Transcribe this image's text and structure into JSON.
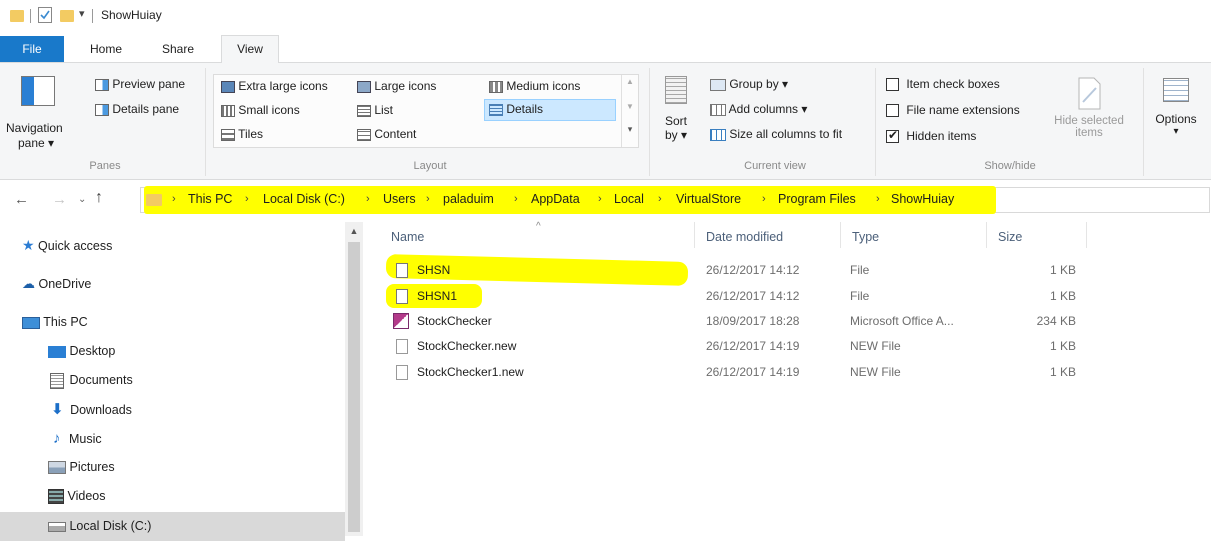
{
  "window": {
    "title": "ShowHuiay"
  },
  "tabs": [
    {
      "label": "File"
    },
    {
      "label": "Home"
    },
    {
      "label": "Share"
    },
    {
      "label": "View"
    }
  ],
  "ribbon": {
    "panes": {
      "navigation_pane_line1": "Navigation",
      "navigation_pane_line2": "pane ▾",
      "preview_pane": "Preview pane",
      "details_pane": "Details pane",
      "group_label": "Panes"
    },
    "layout": {
      "extra_large_icons": "Extra large icons",
      "large_icons": "Large icons",
      "medium_icons": "Medium icons",
      "small_icons": "Small icons",
      "list": "List",
      "details": "Details",
      "tiles": "Tiles",
      "content": "Content",
      "group_label": "Layout",
      "selected": "Details"
    },
    "current_view": {
      "sort_line1": "Sort",
      "sort_line2": "by ▾",
      "group_by": "Group by ▾",
      "add_columns": "Add columns ▾",
      "size_all_columns": "Size all columns to fit",
      "group_label": "Current view"
    },
    "show_hide": {
      "item_check_boxes": {
        "label": "Item check boxes",
        "checked": false
      },
      "file_name_extensions": {
        "label": "File name extensions",
        "checked": false
      },
      "hidden_items": {
        "label": "Hidden items",
        "checked": true
      },
      "hide_selected_line1": "Hide selected",
      "hide_selected_line2": "items",
      "group_label": "Show/hide"
    },
    "options": {
      "label": "Options",
      "arrow": "▾"
    }
  },
  "address_bar": {
    "crumbs": [
      "This PC",
      "Local Disk (C:)",
      "Users",
      "paladuim",
      "AppData",
      "Local",
      "VirtualStore",
      "Program Files",
      "ShowHuiay"
    ],
    "highlight_color": "#ffff00"
  },
  "nav_pane": {
    "items": [
      {
        "label": "Quick access",
        "icon": "star-icon"
      },
      {
        "label": "OneDrive",
        "icon": "cloud-icon"
      },
      {
        "label": "This PC",
        "icon": "computer-icon"
      },
      {
        "label": "Desktop",
        "icon": "desktop-icon"
      },
      {
        "label": "Documents",
        "icon": "documents-icon"
      },
      {
        "label": "Downloads",
        "icon": "downloads-icon"
      },
      {
        "label": "Music",
        "icon": "music-icon"
      },
      {
        "label": "Pictures",
        "icon": "pictures-icon"
      },
      {
        "label": "Videos",
        "icon": "videos-icon"
      },
      {
        "label": "Local Disk (C:)",
        "icon": "drive-icon",
        "selected": true
      }
    ]
  },
  "file_list": {
    "columns": {
      "name": "Name",
      "date_modified": "Date modified",
      "type": "Type",
      "size": "Size"
    },
    "rows": [
      {
        "name": "SHSN",
        "date": "26/12/2017 14:12",
        "type": "File",
        "size": "1 KB",
        "icon": "file-icon",
        "highlighted": true
      },
      {
        "name": "SHSN1",
        "date": "26/12/2017 14:12",
        "type": "File",
        "size": "1 KB",
        "icon": "file-icon",
        "highlighted": true
      },
      {
        "name": "StockChecker",
        "date": "18/09/2017 18:28",
        "type": "Microsoft Office A...",
        "size": "234 KB",
        "icon": "access-app-icon",
        "highlighted": false
      },
      {
        "name": "StockChecker.new",
        "date": "26/12/2017 14:19",
        "type": "NEW File",
        "size": "1 KB",
        "icon": "file-icon",
        "highlighted": false
      },
      {
        "name": "StockChecker1.new",
        "date": "26/12/2017 14:19",
        "type": "NEW File",
        "size": "1 KB",
        "icon": "file-icon",
        "highlighted": false
      }
    ]
  },
  "colors": {
    "file_tab": "#1979ca",
    "highlight": "#ffff00",
    "selected_nav": "#d9d9d9",
    "details_selected": "#cce8ff"
  }
}
